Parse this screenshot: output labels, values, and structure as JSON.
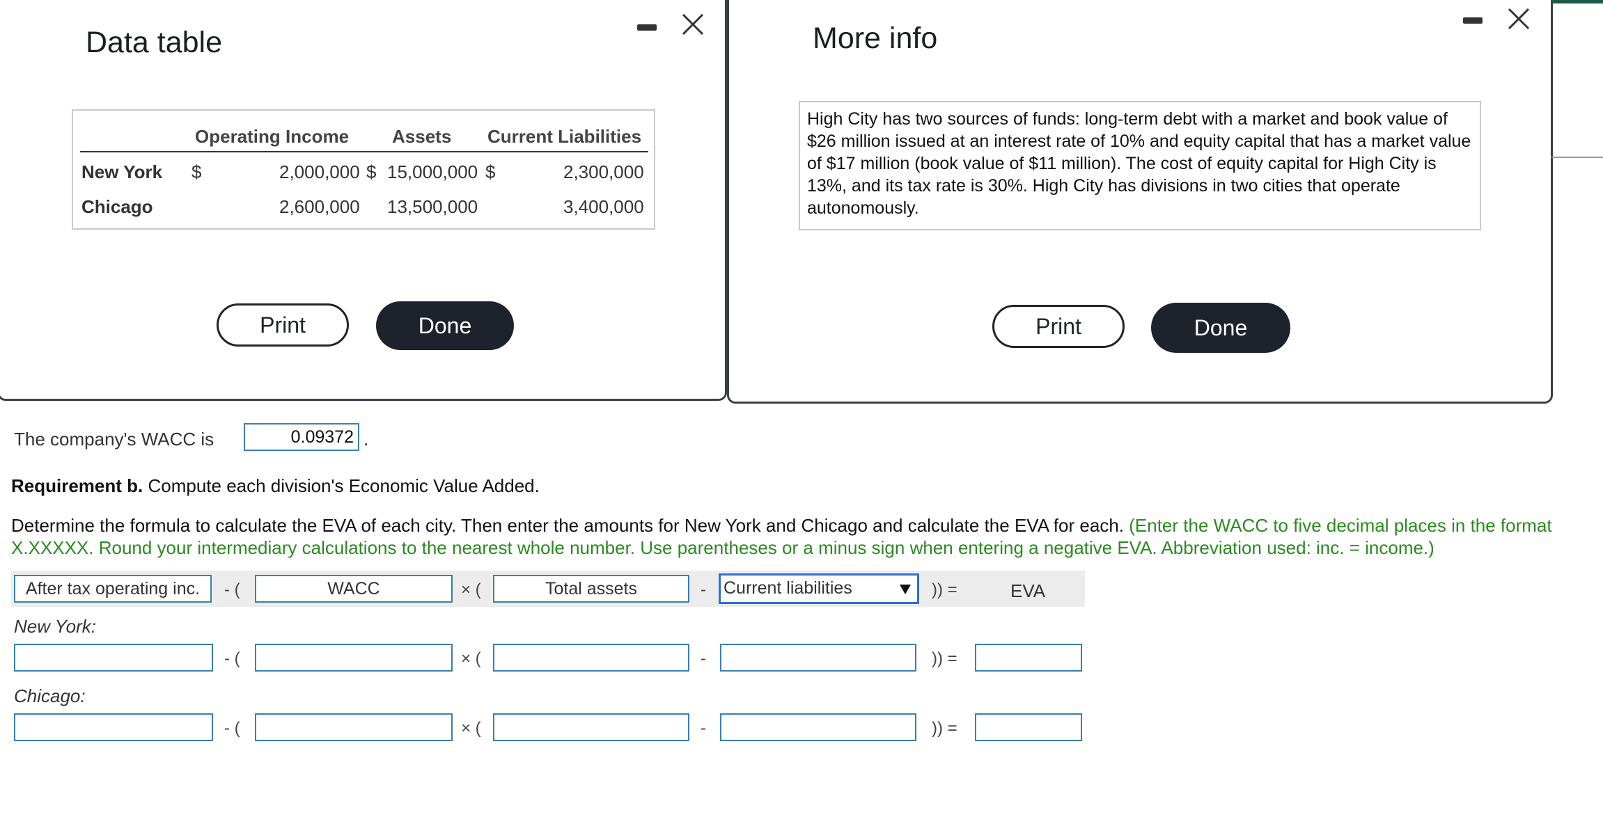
{
  "data_table": {
    "title": "Data table",
    "columns": [
      "Operating Income",
      "Assets",
      "Current Liabilities"
    ],
    "rows": [
      {
        "label": "New York",
        "cur1": "$",
        "op_income": "2,000,000",
        "cur2": "$",
        "assets": "15,000,000",
        "cur3": "$",
        "liabilities": "2,300,000"
      },
      {
        "label": "Chicago",
        "op_income": "2,600,000",
        "assets": "13,500,000",
        "liabilities": "3,400,000"
      }
    ],
    "print_label": "Print",
    "done_label": "Done"
  },
  "more_info": {
    "title": "More info",
    "text": "High City has two sources of funds: long-term debt with a market and book value of $26 million issued at an interest rate of 10% and equity capital that has a market value of $17 million (book value of $11 million). The cost of equity capital for High City is 13%, and its tax rate is 30%. High City has divisions in two cities that operate autonomously.",
    "print_label": "Print",
    "done_label": "Done"
  },
  "wacc": {
    "prefix": "The company's WACC is",
    "value": "0.09372",
    "suffix": "."
  },
  "requirement": {
    "bold": "Requirement b.",
    "text": "Compute each division's Economic Value Added."
  },
  "instructions": {
    "line1_black": "Determine the formula to calculate the EVA of each city. Then enter the amounts for New York and Chicago and calculate the EVA for each.",
    "line1_green": "(Enter the WACC to five decimal places in the format",
    "line2_green": "X.XXXXX. Round your intermediary calculations to the nearest whole number. Use parentheses or a minus sign when entering a negative EVA. Abbreviation used: inc. = income.)"
  },
  "formula": {
    "term1": "After tax operating inc.",
    "op1": "- (",
    "term2": "WACC",
    "op2": "× (",
    "term3": "Total assets",
    "op3": "-",
    "term4_selected": "Current liabilities",
    "op4": ")) =",
    "result": "EVA"
  },
  "rows": [
    {
      "label": "New York:",
      "op1": "- (",
      "op2": "× (",
      "op3": "-",
      "op4": ")) ="
    },
    {
      "label": "Chicago:",
      "op1": "- (",
      "op2": "× (",
      "op3": "-",
      "op4": ")) ="
    }
  ],
  "icons": {
    "minimize": "minimize-icon",
    "close": "close-icon",
    "dropdown": "dropdown-arrow-icon"
  }
}
